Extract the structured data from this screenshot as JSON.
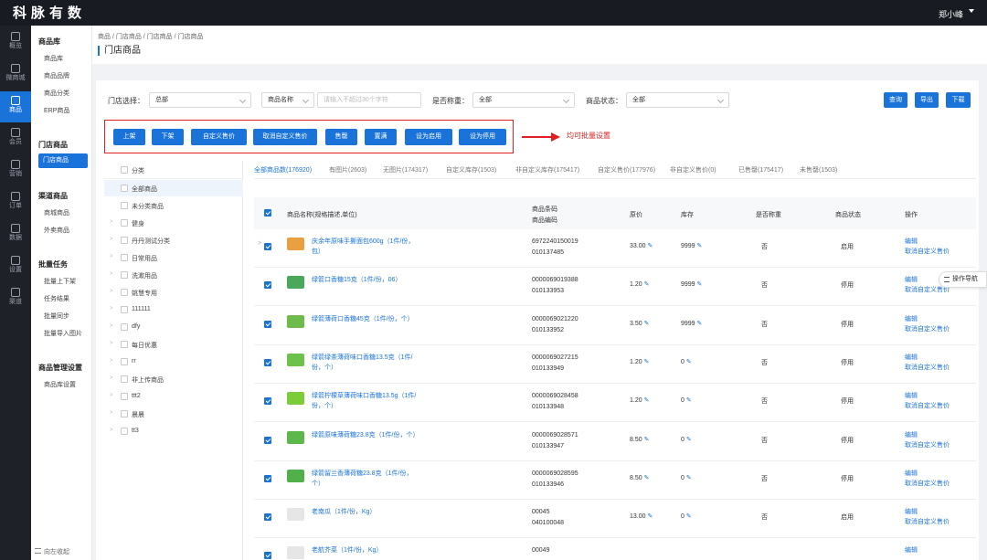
{
  "app": {
    "logo": "科脉有数",
    "logo_sub": "科脉有数",
    "user": "郑小峰"
  },
  "rail": [
    {
      "label": "概览",
      "icon": "home-icon"
    },
    {
      "label": "微商城",
      "icon": "shop-icon"
    },
    {
      "label": "商品",
      "icon": "bag-icon",
      "active": true
    },
    {
      "label": "会员",
      "icon": "crown-icon"
    },
    {
      "label": "营销",
      "icon": "tag-icon"
    },
    {
      "label": "订单",
      "icon": "order-icon"
    },
    {
      "label": "数据",
      "icon": "chart-icon"
    },
    {
      "label": "设置",
      "icon": "gear-icon"
    },
    {
      "label": "渠道",
      "icon": "channel-icon"
    }
  ],
  "subnav": {
    "group1_title": "商品库",
    "group1_items": [
      "商品库",
      "商品品牌",
      "商品分类",
      "ERP商品"
    ],
    "group2_title": "门店商品",
    "group2_items": [
      "门店商品"
    ],
    "group3_title": "渠道商品",
    "group3_items": [
      "商城商品",
      "外卖商品"
    ],
    "group4_title": "批量任务",
    "group4_items": [
      "批量上下架",
      "任务结果",
      "批量同步",
      "批量导入图片"
    ],
    "group5_title": "商品管理设置",
    "group5_items": [
      "商品库设置"
    ],
    "collapse": "向左收起"
  },
  "header": {
    "breadcrumb": "商品 / 门店商品 / 门店商品 / 门店商品",
    "title": "门店商品"
  },
  "filters": {
    "store_label": "门店选择：",
    "store_value": "总部",
    "field_value": "商品名称",
    "search_placeholder": "请输入不超过30个字符",
    "weigh_label": "是否称重：",
    "weigh_value": "全部",
    "status_label": "商品状态：",
    "status_value": "全部",
    "query": "查询",
    "export": "导出",
    "download": "下载"
  },
  "batch_buttons": [
    "上架",
    "下架",
    "自定义售价",
    "取消自定义售价",
    "售罄",
    "置满",
    "设为启用",
    "设为停用"
  ],
  "annotation": "均可批量设置",
  "tree": {
    "header": "分类",
    "items": [
      "全部商品",
      "未分类商品",
      "健身",
      "丹丹测试分类",
      "日常用品",
      "洗漱用品",
      "姚慧专用",
      "111111",
      "dfy",
      "每日优惠",
      "rr",
      "非上传商品",
      "ttt2",
      "晨晨",
      "tt3"
    ]
  },
  "stats": [
    "全部商品数(176920)",
    "有图片(2603)",
    "无图片(174317)",
    "自定义库存(1503)",
    "非自定义库存(175417)",
    "自定义售价(177976)",
    "非自定义售价(0)",
    "已售罄(175417)",
    "未售罄(1503)"
  ],
  "table": {
    "columns": {
      "name": "商品名称(规格描述,单位)",
      "barcode": "商品条码",
      "code": "商品编码",
      "price": "原价",
      "stock": "库存",
      "weigh": "是否称重",
      "status": "商品状态",
      "ops": "操作"
    },
    "op_edit": "编辑",
    "op_cancel": "取消自定义售价",
    "rows": [
      {
        "name": "庆余年原味手撕面包600g（1件/份，包）",
        "barcode": "6972240150019",
        "code": "010137485",
        "price": "33.00",
        "stock": "9999",
        "weigh": "否",
        "status": "启用",
        "thumb": "#e8a040"
      },
      {
        "name": "绿箭口香糖15克（1件/份，06）",
        "barcode": "0000069019388",
        "code": "010133953",
        "price": "1.20",
        "stock": "9999",
        "weigh": "否",
        "status": "停用",
        "thumb": "#4aa85a"
      },
      {
        "name": "绿箭薄荷口香糖45克（1件/份，个）",
        "barcode": "0000069021220",
        "code": "010133952",
        "price": "3.50",
        "stock": "9999",
        "weigh": "否",
        "status": "停用",
        "thumb": "#6dbb4a"
      },
      {
        "name": "绿箭绿茶薄荷味口香糖13.5克（1件/份，个）",
        "barcode": "0000069027215",
        "code": "010133949",
        "price": "1.20",
        "stock": "0",
        "weigh": "否",
        "status": "停用",
        "thumb": "#6cc24a"
      },
      {
        "name": "绿箭柠檬草薄荷味口香糖13.5g（1件/份，个）",
        "barcode": "0000069028458",
        "code": "010133948",
        "price": "1.20",
        "stock": "0",
        "weigh": "否",
        "status": "停用",
        "thumb": "#7ccc3a"
      },
      {
        "name": "绿箭原味薄荷糖23.8克（1件/份，个）",
        "barcode": "0000069028571",
        "code": "010133947",
        "price": "8.50",
        "stock": "0",
        "weigh": "否",
        "status": "停用",
        "thumb": "#5cb84a"
      },
      {
        "name": "绿箭留兰香薄荷糖23.8克（1件/份，个）",
        "barcode": "0000069028595",
        "code": "010133946",
        "price": "8.50",
        "stock": "0",
        "weigh": "否",
        "status": "停用",
        "thumb": "#52b04a"
      },
      {
        "name": "老南瓜（1件/份，Kg）",
        "barcode": "00045",
        "code": "040100048",
        "price": "13.00",
        "stock": "0",
        "weigh": "否",
        "status": "启用",
        "thumb": "#e6e6e6"
      },
      {
        "name": "老航芥菜（1件/份，Kg）",
        "barcode": "00049",
        "code": "",
        "price": "",
        "stock": "",
        "weigh": "",
        "status": "",
        "thumb": "#e6e6e6"
      }
    ]
  },
  "floatnav": "操作导航"
}
